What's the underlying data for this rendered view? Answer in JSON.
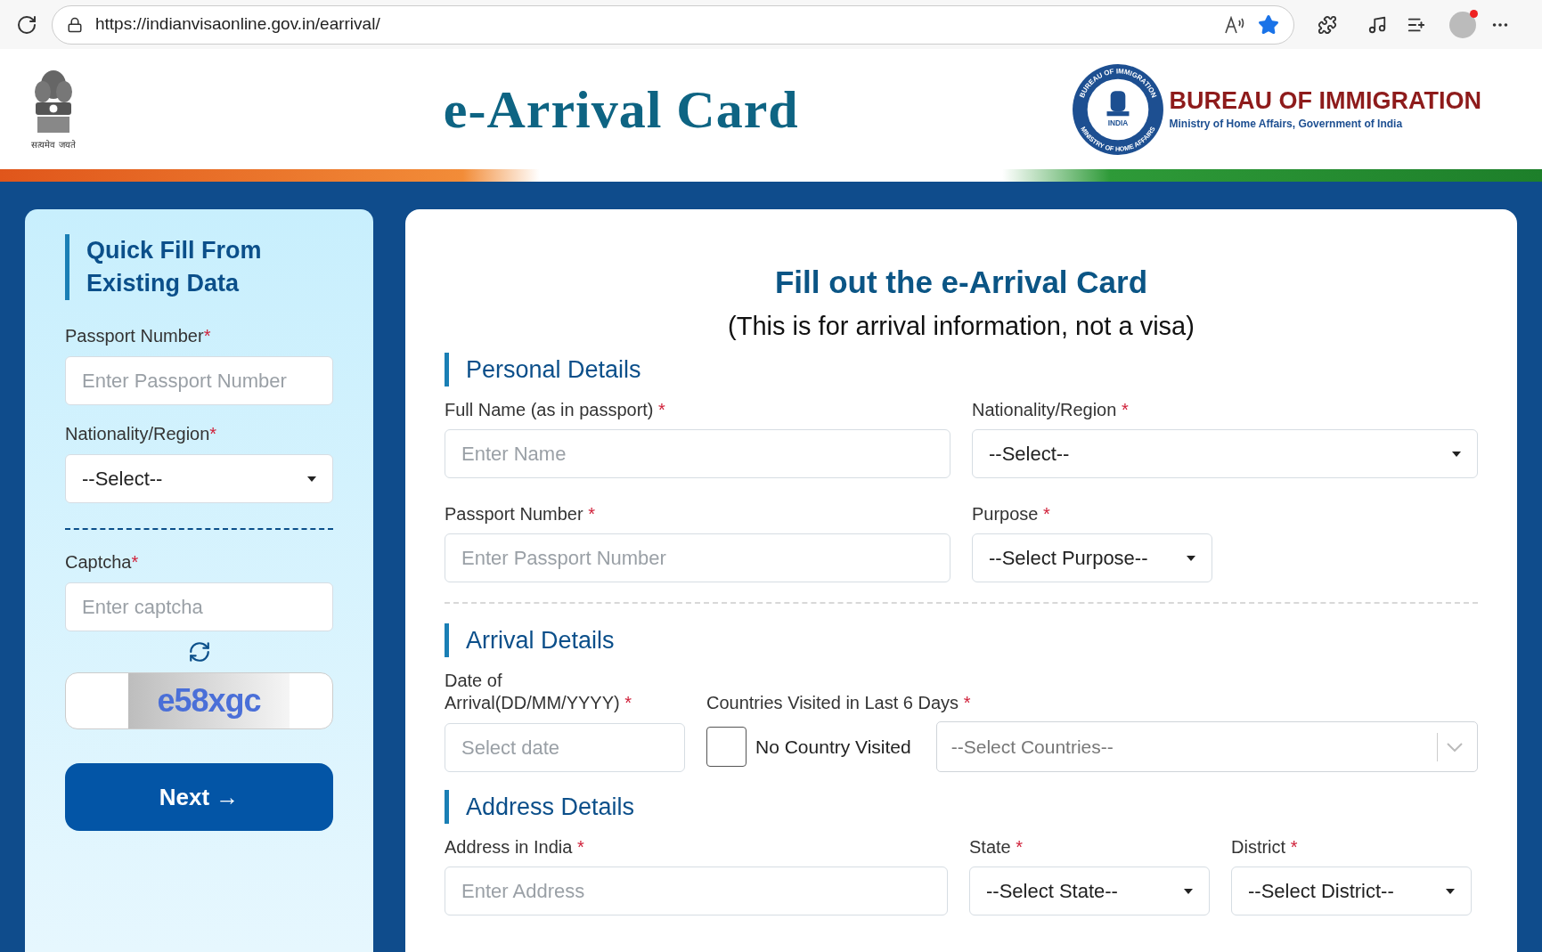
{
  "browser": {
    "url": "https://indianvisaonline.gov.in/earrival/",
    "favorite": true
  },
  "header": {
    "emblem_motto": "सत्यमेव जयते",
    "title": "e-Arrival Card",
    "seal": {
      "top": "BUREAU OF IMMIGRATION",
      "center": "INDIA",
      "bottom": "MINISTRY OF HOME AFFAIRS"
    },
    "org_name": "BUREAU OF IMMIGRATION",
    "org_sub": "Ministry of Home Affairs, Government of India"
  },
  "quick_fill": {
    "title": "Quick Fill From Existing Data",
    "fields": [
      {
        "kind": "input",
        "label": "Passport Number",
        "asterisk": "*",
        "placeholder": "Enter Passport Number"
      },
      {
        "kind": "select",
        "label": "Nationality/Region",
        "asterisk": "*",
        "value": "--Select--"
      }
    ],
    "captcha": {
      "label": "Captcha",
      "asterisk": "*",
      "placeholder": "Enter captcha",
      "image_text": "e58xgc"
    },
    "button": "Next →"
  },
  "form": {
    "title": "Fill out the e-Arrival Card",
    "subtitle": "(This is for arrival information, not a visa)",
    "sections": [
      {
        "title": "Personal Details",
        "fields": [
          {
            "kind": "input",
            "label": "Full Name (as in passport)",
            "asterisk": "*",
            "placeholder": "Enter Name"
          },
          {
            "kind": "select",
            "label": "Nationality/Region",
            "asterisk": "*",
            "value": "--Select--"
          },
          {
            "kind": "input",
            "label": "Passport Number",
            "asterisk": "*",
            "placeholder": "Enter Passport Number"
          },
          {
            "kind": "select",
            "label": "Purpose",
            "asterisk": "*",
            "value": "--Select Purpose--"
          }
        ]
      },
      {
        "title": "Arrival Details",
        "fields": [
          {
            "kind": "date",
            "label": "Date of Arrival(DD/MM/YYYY)",
            "asterisk": "*",
            "placeholder": "Select date"
          },
          {
            "kind": "countries",
            "label": "Countries Visited in Last 6 Days",
            "asterisk": "*",
            "checkbox": {
              "label": "No Country Visited",
              "checked": false
            },
            "placeholder": "--Select Countries--"
          }
        ]
      },
      {
        "title": "Address Details",
        "fields": [
          {
            "kind": "input",
            "label": "Address in India",
            "asterisk": "*",
            "placeholder": "Enter Address"
          },
          {
            "kind": "select",
            "label": "State",
            "asterisk": "*",
            "value": "--Select State--"
          },
          {
            "kind": "select",
            "label": "District",
            "asterisk": "*",
            "value": "--Select District--"
          }
        ]
      }
    ]
  }
}
